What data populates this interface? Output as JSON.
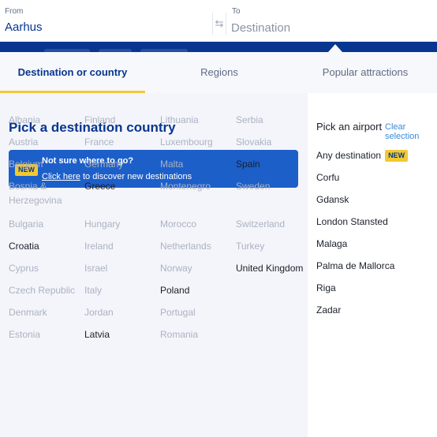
{
  "search": {
    "from_label": "From",
    "from_value": "Aarhus",
    "to_label": "To",
    "to_placeholder": "Destination",
    "swap_icon": "⇆"
  },
  "tabs": [
    {
      "label": "Destination or country",
      "active": true
    },
    {
      "label": "Regions",
      "active": false
    },
    {
      "label": "Popular attractions",
      "active": false
    }
  ],
  "main": {
    "title": "Pick a destination country",
    "banner": {
      "badge": "NEW",
      "title": "Not sure where to go?",
      "link": "Click here",
      "rest": " to discover new destinations"
    },
    "columns": [
      [
        {
          "name": "Albania",
          "available": false
        },
        {
          "name": "Austria",
          "available": false
        },
        {
          "name": "Belgium",
          "available": false
        },
        {
          "name": "Bosnia & Herzegovina",
          "available": false
        },
        {
          "name": "Bulgaria",
          "available": false
        },
        {
          "name": "Croatia",
          "available": true
        },
        {
          "name": "Cyprus",
          "available": false
        },
        {
          "name": "Czech Republic",
          "available": false
        },
        {
          "name": "Denmark",
          "available": false
        },
        {
          "name": "Estonia",
          "available": false
        }
      ],
      [
        {
          "name": "Finland",
          "available": false
        },
        {
          "name": "France",
          "available": false
        },
        {
          "name": "Germany",
          "available": false
        },
        {
          "name": "Greece",
          "available": true
        },
        {
          "name": "Hungary",
          "available": false
        },
        {
          "name": "Ireland",
          "available": false
        },
        {
          "name": "Israel",
          "available": false
        },
        {
          "name": "Italy",
          "available": false
        },
        {
          "name": "Jordan",
          "available": false
        },
        {
          "name": "Latvia",
          "available": true
        }
      ],
      [
        {
          "name": "Lithuania",
          "available": false
        },
        {
          "name": "Luxembourg",
          "available": false
        },
        {
          "name": "Malta",
          "available": false
        },
        {
          "name": "Montenegro",
          "available": false
        },
        {
          "name": "Morocco",
          "available": false
        },
        {
          "name": "Netherlands",
          "available": false
        },
        {
          "name": "Norway",
          "available": false
        },
        {
          "name": "Poland",
          "available": true
        },
        {
          "name": "Portugal",
          "available": false
        },
        {
          "name": "Romania",
          "available": false
        }
      ],
      [
        {
          "name": "Serbia",
          "available": false
        },
        {
          "name": "Slovakia",
          "available": false
        },
        {
          "name": "Spain",
          "available": true
        },
        {
          "name": "Sweden",
          "available": false
        },
        {
          "name": "Switzerland",
          "available": false
        },
        {
          "name": "Turkey",
          "available": false
        },
        {
          "name": "United Kingdom",
          "available": true
        }
      ]
    ]
  },
  "sidebar": {
    "title": "Pick an airport",
    "clear": "Clear selection",
    "airports": [
      {
        "name": "Any destination",
        "badge": "NEW"
      },
      {
        "name": "Corfu"
      },
      {
        "name": "Gdansk"
      },
      {
        "name": "London Stansted"
      },
      {
        "name": "Malaga"
      },
      {
        "name": "Palma de Mallorca"
      },
      {
        "name": "Riga"
      },
      {
        "name": "Zadar"
      }
    ]
  },
  "colors": {
    "brand_blue": "#073590",
    "accent_yellow": "#f1c933",
    "banner_blue": "#1d5fc9",
    "link_blue": "#3a8ad9"
  }
}
